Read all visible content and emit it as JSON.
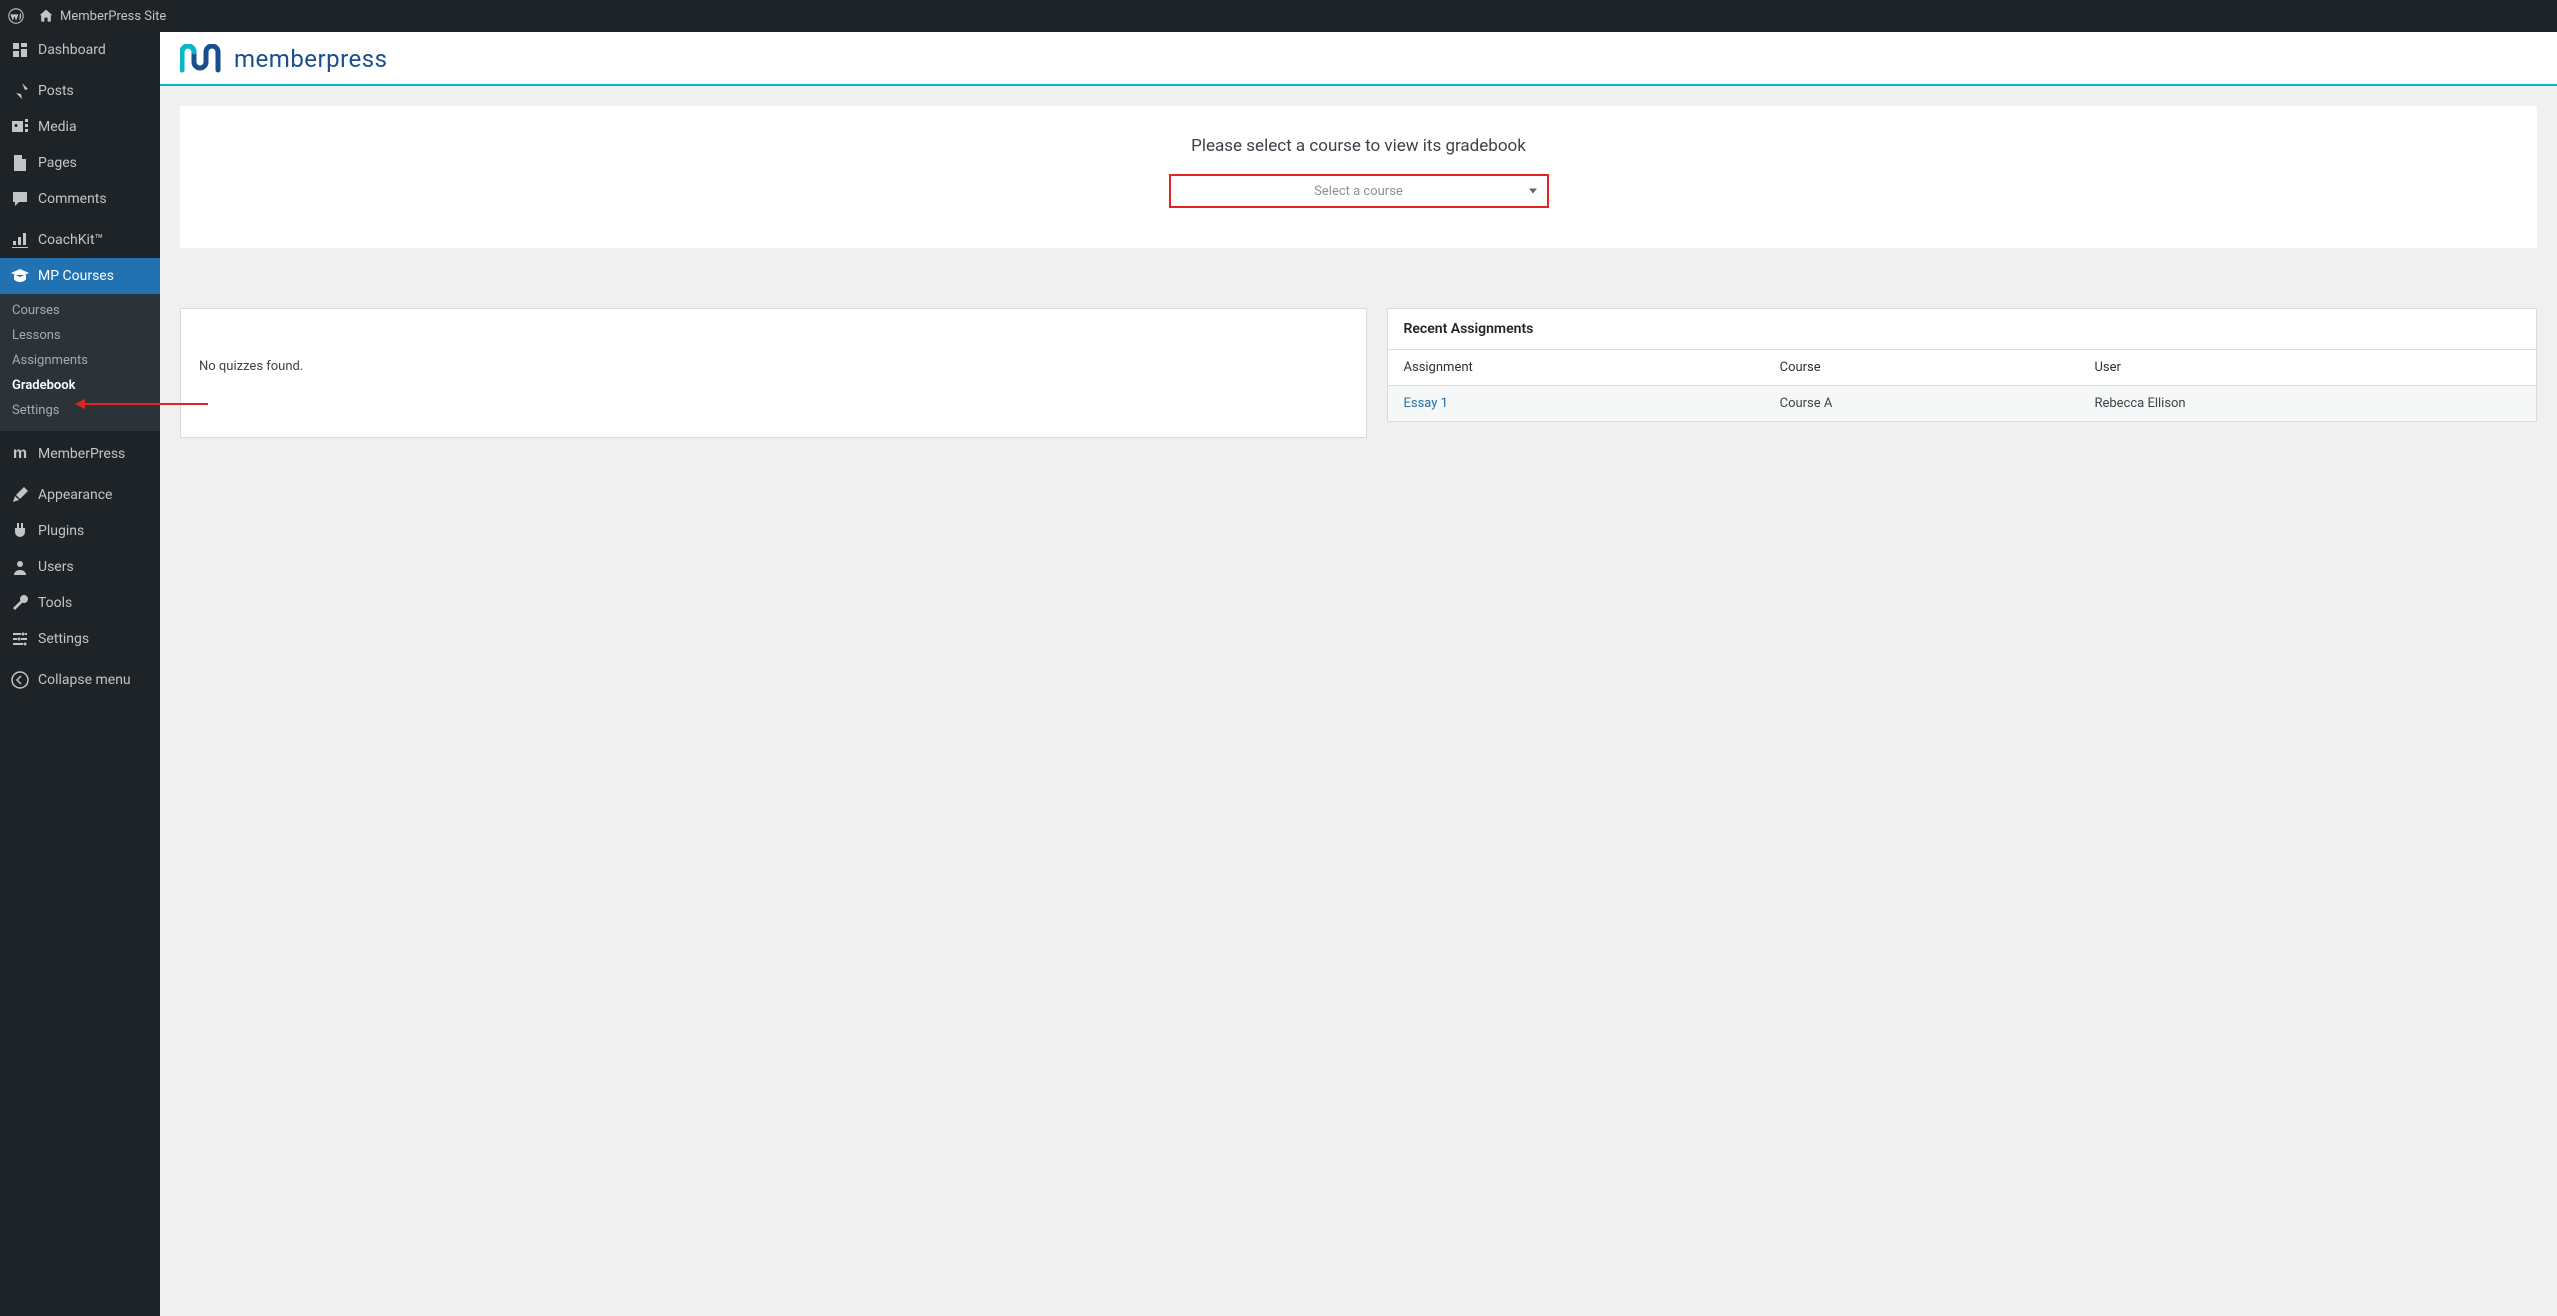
{
  "adminbar": {
    "site_name": "MemberPress Site"
  },
  "sidebar": {
    "dashboard": "Dashboard",
    "posts": "Posts",
    "media": "Media",
    "pages": "Pages",
    "comments": "Comments",
    "coachkit": "CoachKit™",
    "mp_courses": "MP Courses",
    "submenu": {
      "courses": "Courses",
      "lessons": "Lessons",
      "assignments": "Assignments",
      "gradebook": "Gradebook",
      "settings": "Settings"
    },
    "memberpress": "MemberPress",
    "appearance": "Appearance",
    "plugins": "Plugins",
    "users": "Users",
    "tools": "Tools",
    "settings": "Settings",
    "collapse": "Collapse menu"
  },
  "header": {
    "brand": "memberpress"
  },
  "main": {
    "select_prompt": "Please select a course to view its gradebook",
    "select_placeholder": "Select a course",
    "no_quizzes": "No quizzes found.",
    "recent_assignments_title": "Recent Assignments",
    "table_headers": {
      "assignment": "Assignment",
      "course": "Course",
      "user": "User"
    },
    "assignments": [
      {
        "title": "Essay 1",
        "course": "Course A",
        "user": "Rebecca Ellison"
      }
    ]
  }
}
